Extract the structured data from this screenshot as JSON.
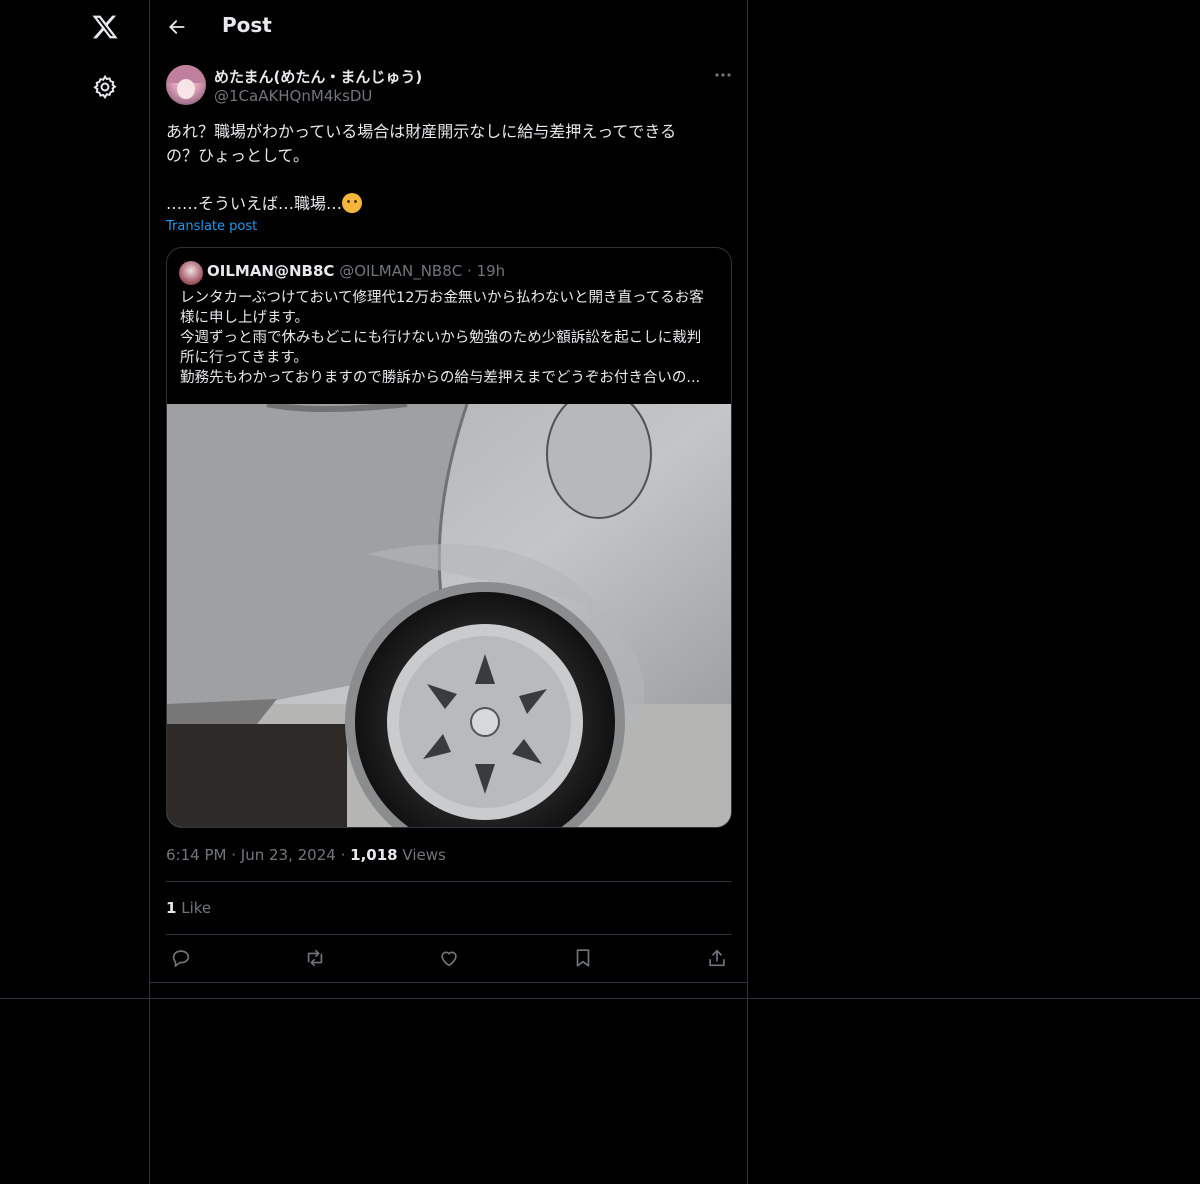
{
  "header": {
    "title": "Post"
  },
  "post": {
    "display_name": "めたまん(めたん・まんじゅう)",
    "handle": "@1CaAKHQnM4ksDU",
    "text_line1": "あれ？職場がわかっている場合は財産開示なしに給与差押えってできる",
    "text_line2": "の？ひょっとして。",
    "text_line3": "……そういえば…職場…",
    "emoji": "thinking-face",
    "translate_label": "Translate post",
    "time": "6:14 PM",
    "date": "Jun 23, 2024",
    "views_count": "1,018",
    "views_label": "Views",
    "likes_count": "1",
    "likes_label": "Like"
  },
  "quoted": {
    "display_name": "OILMAN@NB8C",
    "handle": "@OILMAN_NB8C",
    "time_ago": "19h",
    "line1": "レンタカーぶつけておいて修理代12万お金無いから払わないと開き直ってるお客",
    "line2": "様に申し上げます。",
    "line3": "今週ずっと雨で休みもどこにも行けないから勉強のため少額訴訟を起こしに裁判",
    "line4": "所に行ってきます。",
    "line5": "勤務先もわかっておりますので勝訴からの給与差押えまでどうぞお付き合いの..."
  },
  "dot": "·",
  "icons": {
    "logo": "x-logo-icon",
    "settings": "gear-icon",
    "back": "back-arrow-icon",
    "more": "more-icon",
    "reply": "reply-icon",
    "repost": "repost-icon",
    "like": "heart-icon",
    "bookmark": "bookmark-icon",
    "share": "share-icon"
  },
  "colors": {
    "background": "#000000",
    "text": "#e7e9ea",
    "muted": "#71767b",
    "link": "#1d9bf0",
    "border": "#2f3336"
  }
}
